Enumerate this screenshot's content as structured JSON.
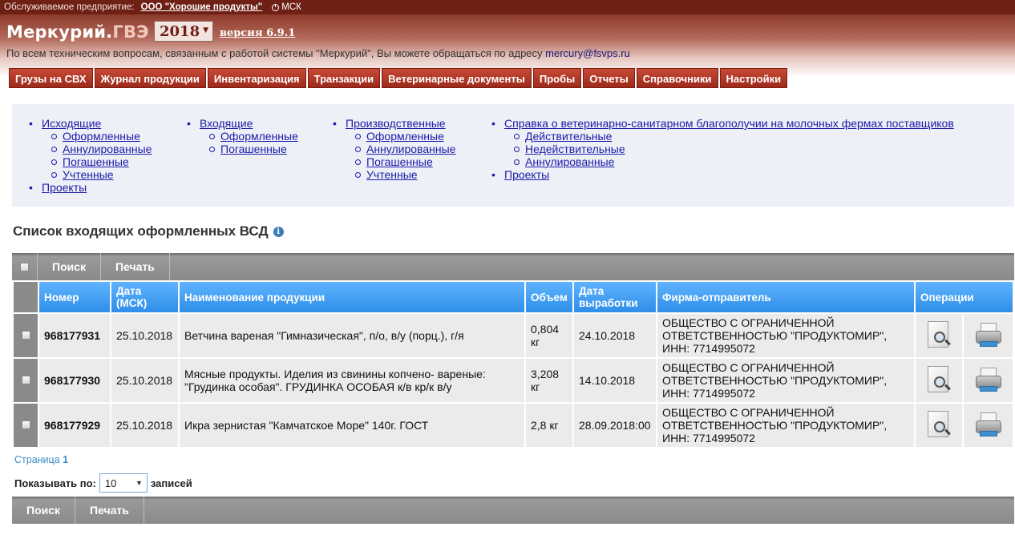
{
  "topbar": {
    "org_label": "Обслуживаемое предприятие:",
    "org_name": "ООО \"Хорошие продукты\"",
    "timezone": "МСК"
  },
  "header": {
    "logo_main": "Меркурий.",
    "logo_accent": "ГВЭ",
    "year": "2018",
    "version": "версия 6.9.1",
    "support_text": "По всем техническим вопросам, связанным с работой системы \"Меркурий\", Вы можете обращаться по адресу",
    "support_email": "mercury@fsvps.ru"
  },
  "nav": [
    "Грузы на СВХ",
    "Журнал продукции",
    "Инвентаризация",
    "Транзакции",
    "Ветеринарные документы",
    "Пробы",
    "Отчеты",
    "Справочники",
    "Настройки"
  ],
  "filters": {
    "col1": {
      "main": "Исходящие",
      "items": [
        "Оформленные",
        "Аннулированные",
        "Погашенные",
        "Учтенные"
      ],
      "extra": "Проекты"
    },
    "col2": {
      "main": "Входящие",
      "items": [
        "Оформленные",
        "Погашенные"
      ]
    },
    "col3": {
      "main": "Производственные",
      "items": [
        "Оформленные",
        "Аннулированные",
        "Погашенные",
        "Учтенные"
      ]
    },
    "col4": {
      "main": "Справка о ветеринарно-санитарном благополучии на молочных фермах поставщиков",
      "items": [
        "Действительные",
        "Недействительные",
        "Аннулированные"
      ],
      "extra": "Проекты"
    }
  },
  "page_title": "Список входящих оформленных ВСД",
  "toolbar": {
    "search_label": "Поиск",
    "print_label": "Печать"
  },
  "table": {
    "headers": {
      "number": "Номер",
      "date": "Дата (МСК)",
      "product": "Наименование продукции",
      "volume": "Объем",
      "prod_date": "Дата выработки",
      "sender": "Фирма-отправитель",
      "ops": "Операции"
    },
    "rows": [
      {
        "number": "968177931",
        "date": "25.10.2018",
        "product": "Ветчина вареная \"Гимназическая\", п/о, в/у (порц.), г/я",
        "volume": "0,804 кг",
        "prod_date": "24.10.2018",
        "sender": "ОБЩЕСТВО С ОГРАНИЧЕННОЙ ОТВЕТСТВЕННОСТЬЮ \"ПРОДУКТОМИР\", ИНН: 7714995072"
      },
      {
        "number": "968177930",
        "date": "25.10.2018",
        "product": "Мясные продукты. Иделия из свинины копчено- вареные: \"Грудинка особая\". ГРУДИНКА ОСОБАЯ к/в кр/к в/у",
        "volume": "3,208 кг",
        "prod_date": "14.10.2018",
        "sender": "ОБЩЕСТВО С ОГРАНИЧЕННОЙ ОТВЕТСТВЕННОСТЬЮ \"ПРОДУКТОМИР\", ИНН: 7714995072"
      },
      {
        "number": "968177929",
        "date": "25.10.2018",
        "product": "Икра зернистая \"Камчатское Море\" 140г. ГОСТ",
        "volume": "2,8 кг",
        "prod_date": "28.09.2018:00",
        "sender": "ОБЩЕСТВО С ОГРАНИЧЕННОЙ ОТВЕТСТВЕННОСТЬЮ \"ПРОДУКТОМИР\", ИНН: 7714995072"
      }
    ]
  },
  "pager": {
    "label": "Страница",
    "current": "1"
  },
  "pagesize": {
    "label": "Показывать по:",
    "value": "10",
    "suffix": "записей"
  },
  "colors": {
    "brand_dark": "#6e2014",
    "nav_red": "#b03a28",
    "header_blue": "#2e8ee8",
    "toolbar_gray": "#8a8a8a"
  },
  "icons": [
    "clock-icon",
    "info-icon",
    "view-document-icon",
    "print-icon",
    "checkbox-icon",
    "dropdown-arrow-icon"
  ]
}
